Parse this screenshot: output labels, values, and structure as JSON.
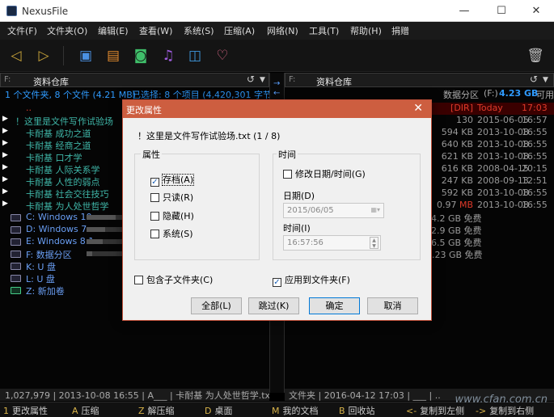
{
  "window": {
    "title": "NexusFile",
    "controls": {
      "minimize": "—",
      "maximize": "☐",
      "close": "✕"
    }
  },
  "menu": [
    "文件(F)",
    "文件夹(O)",
    "编辑(E)",
    "查看(W)",
    "系统(S)",
    "压缩(A)",
    "网络(N)",
    "工具(T)",
    "帮助(H)",
    "捐赠"
  ],
  "toolbar": {
    "icons": [
      "back-arrow-icon",
      "forward-arrow-icon",
      "screen-icon",
      "window-icon",
      "camera-icon",
      "music-icon",
      "bag-icon",
      "heart-icon",
      "trash-icon"
    ]
  },
  "left_pane": {
    "drive": "F:",
    "path": "资料仓库",
    "status": {
      "summary": "1 个文件夹, 8 个文件 (4.21 MB)",
      "selection": "已选择: 8 个项目 (4,420,301 字节)"
    },
    "items": [
      {
        "name": ".."
      },
      {
        "name": "！这里是文件写作试验场"
      },
      {
        "name": "卡耐基 成功之道"
      },
      {
        "name": "卡耐基 经商之道"
      },
      {
        "name": "卡耐基 口才学"
      },
      {
        "name": "卡耐基 人际关系学"
      },
      {
        "name": "卡耐基 人性的弱点"
      },
      {
        "name": "卡耐基 社会交往技巧"
      },
      {
        "name": "卡耐基 为人处世哲学"
      }
    ],
    "drives": [
      {
        "name": "C: Windows 10",
        "usage": 0.55
      },
      {
        "name": "D: Windows 7",
        "usage": 0.35
      },
      {
        "name": "E: Windows 8.1",
        "usage": 0.3
      },
      {
        "name": "F: 数据分区",
        "usage": 0.1
      },
      {
        "name": "K: U 盘",
        "usage": 0
      },
      {
        "name": "L: U 盘",
        "usage": 0
      },
      {
        "name": "Z: 新加卷",
        "usage": 0
      }
    ],
    "footer": "1,027,979 | 2013-10-08 16:55 | A___ | 卡耐基 为人处世哲学.txt"
  },
  "right_pane": {
    "drive": "F:",
    "path": "资料仓库",
    "status": {
      "label": "数据分区",
      "drive": "(F:)",
      "free": "4.23 GB",
      "free_label": "可用"
    },
    "items": [
      {
        "size": "[DIR]",
        "date": "Today",
        "time": "17:03"
      },
      {
        "size": "130",
        "date": "2015-06-05",
        "time": "16:57"
      },
      {
        "size": "594 KB",
        "date": "2013-10-08",
        "time": "16:55"
      },
      {
        "size": "640 KB",
        "date": "2013-10-08",
        "time": "16:55"
      },
      {
        "size": "621 KB",
        "date": "2013-10-08",
        "time": "16:55"
      },
      {
        "size": "616 KB",
        "date": "2008-04-15",
        "time": "20:15"
      },
      {
        "size": "247 KB",
        "date": "2008-09-13",
        "time": "12:51"
      },
      {
        "size": "592 KB",
        "date": "2013-10-08",
        "time": "16:55"
      },
      {
        "size_num": "0.97",
        "size_unit": "MB",
        "date": "2013-10-08",
        "time": "16:55"
      }
    ],
    "free_lines": [
      "4.2 GB 免费",
      "2.9 GB 免费",
      "6.5 GB 免费",
      "4.23 GB 免费"
    ],
    "footer": "文件夹 | 2016-04-12 17:03 | ___ | .."
  },
  "fkeys": [
    {
      "key": "1",
      "label": "更改属性"
    },
    {
      "key": "A",
      "label": "压缩"
    },
    {
      "key": "Z",
      "label": "解压缩"
    },
    {
      "key": "D",
      "label": "桌面"
    },
    {
      "key": "M",
      "label": "我的文档"
    },
    {
      "key": "B",
      "label": "回收站"
    },
    {
      "key": "<-",
      "label": "复制到左侧"
    },
    {
      "key": "->",
      "label": "复制到右侧"
    }
  ],
  "watermark": "www.cfan.com.cn",
  "dialog": {
    "title": "更改属性",
    "close": "✕",
    "filename": "！这里是文件写作试验场.txt (1 / 8)",
    "attr_group": "属性",
    "attrs": [
      {
        "label": "存档(A)",
        "checked": true
      },
      {
        "label": "只读(R)",
        "checked": false
      },
      {
        "label": "隐藏(H)",
        "checked": false
      },
      {
        "label": "系统(S)",
        "checked": false
      }
    ],
    "time_group": "时间",
    "modify_label": "修改日期/时间(G)",
    "date_label": "日期(D)",
    "date_value": "2015/06/05",
    "time_label": "时间(I)",
    "time_value": "16:57:56",
    "include_sub": "包含子文件夹(C)",
    "apply_folder": "应用到文件夹(F)",
    "buttons": {
      "all": "全部(L)",
      "skip": "跳过(K)",
      "ok": "确定",
      "cancel": "取消"
    }
  },
  "colors": {
    "accent": "#cd5e40",
    "folder_text": "#3fb6a8",
    "selection_text": "#2f9bff",
    "drive_text": "#6a9ff5"
  }
}
